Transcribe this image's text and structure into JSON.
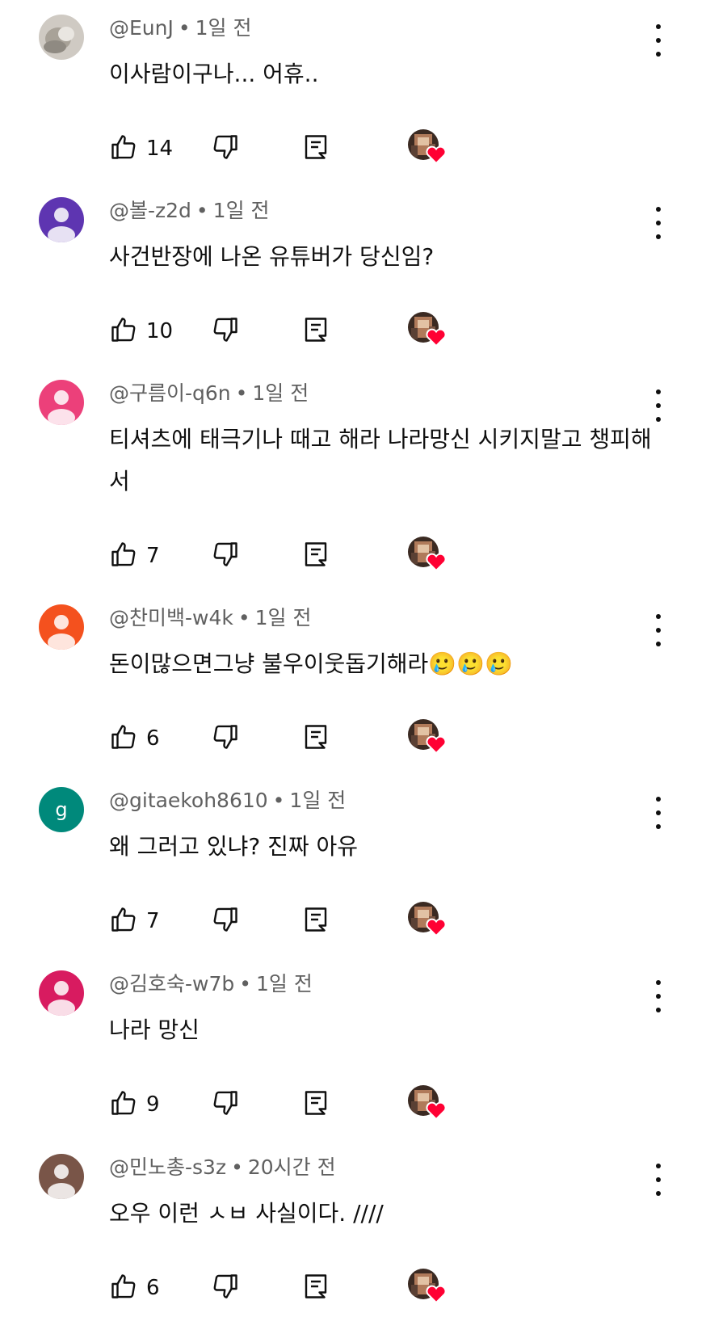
{
  "comments": [
    {
      "author": "@EunJ",
      "time": "1일 전",
      "text": "이사람이구나... 어휴..",
      "likes": "14",
      "avatar_type": "photo",
      "avatar_color": "#bdb8b0"
    },
    {
      "author": "@볼-z2d",
      "time": "1일 전",
      "text": "사건반장에 나온 유튜버가 당신임?",
      "likes": "10",
      "avatar_type": "default",
      "avatar_color": "#5e35b1"
    },
    {
      "author": "@구름이-q6n",
      "time": "1일 전",
      "text": "티셔츠에 태극기나 때고 해라 나라망신 시키지말고 챙피해서",
      "likes": "7",
      "avatar_type": "default",
      "avatar_color": "#ec407a"
    },
    {
      "author": "@찬미백-w4k",
      "time": "1일 전",
      "text": "돈이많으면그냥 불우이웃돕기해라🥲🥲🥲",
      "likes": "6",
      "avatar_type": "default",
      "avatar_color": "#f4511e"
    },
    {
      "author": "@gitaekoh8610",
      "time": "1일 전",
      "text": "왜 그러고 있냐? 진짜 아유",
      "likes": "7",
      "avatar_type": "letter",
      "avatar_letter": "g",
      "avatar_color": "#00897b"
    },
    {
      "author": "@김호숙-w7b",
      "time": "1일 전",
      "text": "나라 망신",
      "likes": "9",
      "avatar_type": "default",
      "avatar_color": "#d81b60"
    },
    {
      "author": "@민노총-s3z",
      "time": "20시간 전",
      "text": "오우 이런 ㅅㅂ 사실이다. ////",
      "likes": "6",
      "avatar_type": "default",
      "avatar_color": "#795548"
    }
  ],
  "icons": {
    "like": "thumb-up-icon",
    "dislike": "thumb-down-icon",
    "reply": "reply-icon",
    "heart": "creator-heart-icon",
    "more": "more-vert-icon"
  },
  "colors": {
    "meta": "#606060",
    "heart": "#ff0033"
  }
}
